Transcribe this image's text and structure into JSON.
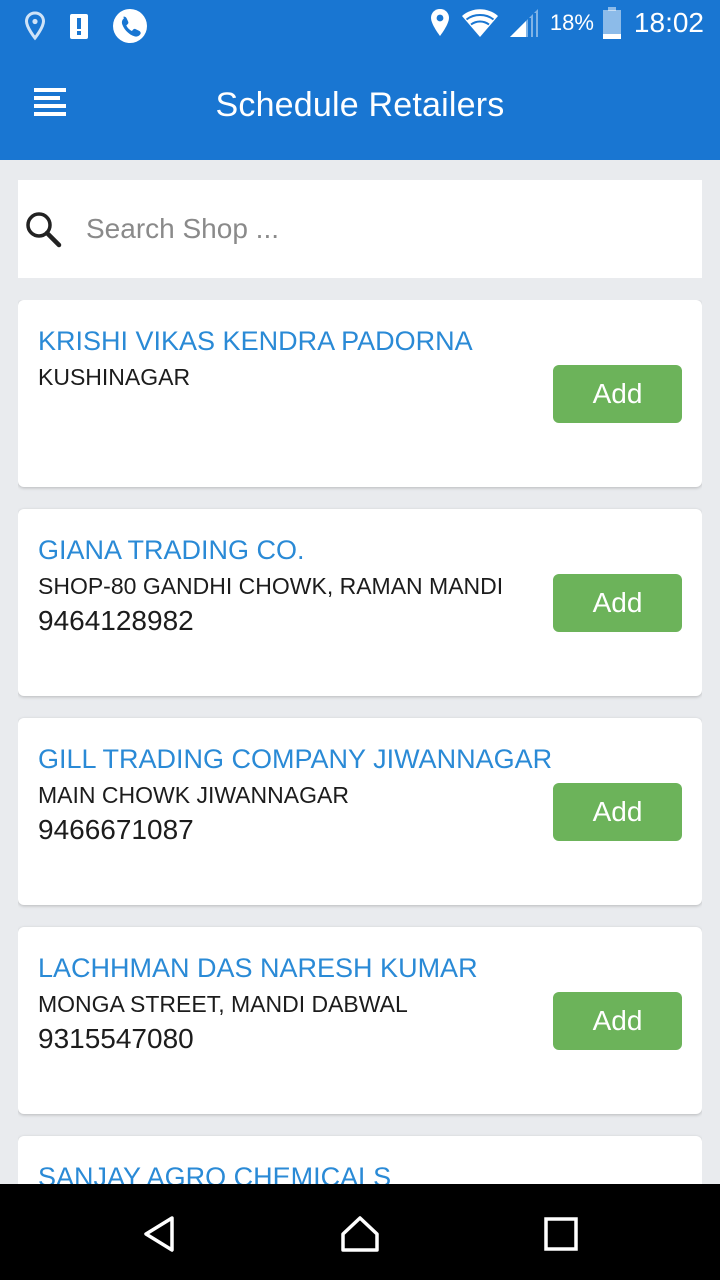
{
  "status_bar": {
    "left_icons": [
      "location-icon",
      "alert-icon",
      "phone-call-icon"
    ],
    "right_icons": [
      "location-icon",
      "wifi-icon",
      "signal-icon",
      "battery-icon"
    ],
    "battery": "18%",
    "time": "18:02"
  },
  "app_bar": {
    "menu_icon": "menu-icon",
    "title": "Schedule Retailers"
  },
  "search": {
    "icon": "search-icon",
    "placeholder": "Search Shop ..."
  },
  "colors": {
    "primary": "#1976d2",
    "retailer_name": "#2a8ad6",
    "add_button": "#6cb35a",
    "background": "#e9ebee"
  },
  "retailers": [
    {
      "name": "KRISHI VIKAS KENDRA PADORNA",
      "address": "KUSHINAGAR",
      "phone": "",
      "action": "Add"
    },
    {
      "name": "GIANA TRADING CO.",
      "address": "SHOP-80 GANDHI CHOWK, RAMAN MANDI",
      "phone": "9464128982",
      "action": "Add"
    },
    {
      "name": "GILL TRADING COMPANY JIWANNAGAR",
      "address": "MAIN CHOWK JIWANNAGAR",
      "phone": "9466671087",
      "action": "Add"
    },
    {
      "name": "LACHHMAN DAS NARESH KUMAR",
      "address": "MONGA STREET, MANDI DABWAL",
      "phone": "9315547080",
      "action": "Add"
    },
    {
      "name": "SANJAY AGRO CHEMICALS",
      "address": "",
      "phone": "",
      "action": ""
    }
  ],
  "nav_bar": {
    "icons": [
      "back-icon",
      "home-icon",
      "recents-icon"
    ]
  }
}
